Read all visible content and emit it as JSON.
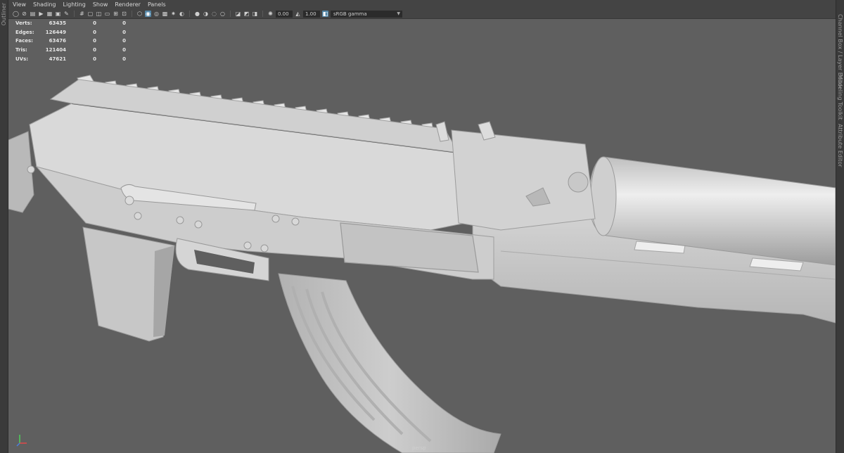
{
  "panels": {
    "left_label": "Outliner",
    "right_labels": [
      "Channel Box / Layer Editor",
      "Modeling Toolkit",
      "Attribute Editor"
    ]
  },
  "menu": [
    "View",
    "Shading",
    "Lighting",
    "Show",
    "Renderer",
    "Panels"
  ],
  "toolbar": {
    "exposure_value": "0.00",
    "gamma_value": "1.00",
    "color_space": "sRGB gamma"
  },
  "hud": {
    "rows": [
      {
        "label": "Verts:",
        "v1": "63435",
        "v2": "0",
        "v3": "0"
      },
      {
        "label": "Edges:",
        "v1": "126449",
        "v2": "0",
        "v3": "0"
      },
      {
        "label": "Faces:",
        "v1": "63476",
        "v2": "0",
        "v3": "0"
      },
      {
        "label": "Tris:",
        "v1": "121404",
        "v2": "0",
        "v3": "0"
      },
      {
        "label": "UVs:",
        "v1": "47621",
        "v2": "0",
        "v3": "0"
      }
    ]
  },
  "viewport": {
    "camera": "persp",
    "background": "#5f5f5f",
    "model_color": "#c9c9c9"
  },
  "icons": [
    "select-icon",
    "lasso-icon",
    "camera-icon",
    "grid-icon",
    "wireframe-icon",
    "smooth-shade-icon",
    "texture-icon",
    "light-icon",
    "shadow-icon",
    "isolate-icon",
    "xray-icon",
    "exposure-icon",
    "gamma-icon",
    "color-management-icon"
  ]
}
